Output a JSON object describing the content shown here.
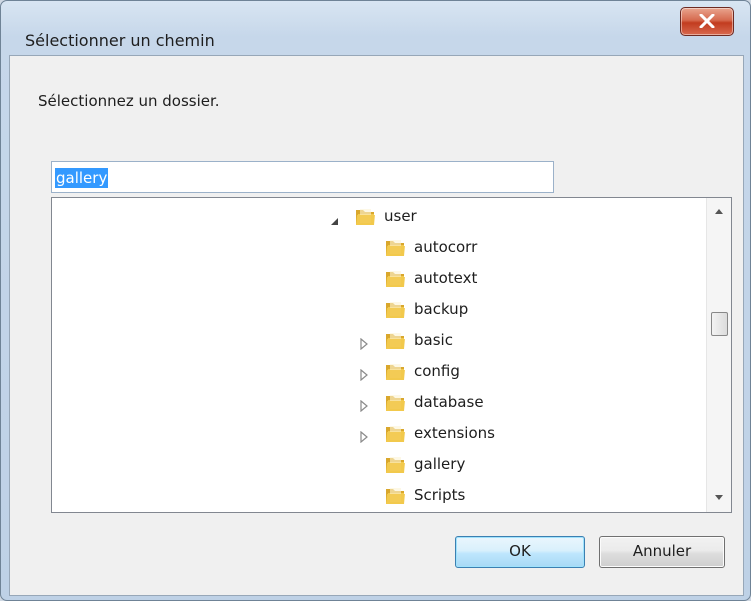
{
  "window": {
    "title": "Sélectionner un chemin",
    "close_label": "X"
  },
  "prompt": "Sélectionnez un dossier.",
  "path_input": {
    "value": "gallery"
  },
  "tree": {
    "items": [
      {
        "label": "user",
        "expander": "expanded"
      },
      {
        "label": "autocorr",
        "expander": "none"
      },
      {
        "label": "autotext",
        "expander": "none"
      },
      {
        "label": "backup",
        "expander": "none"
      },
      {
        "label": "basic",
        "expander": "collapsed"
      },
      {
        "label": "config",
        "expander": "collapsed"
      },
      {
        "label": "database",
        "expander": "collapsed"
      },
      {
        "label": "extensions",
        "expander": "collapsed"
      },
      {
        "label": "gallery",
        "expander": "none"
      },
      {
        "label": "Scripts",
        "expander": "none"
      }
    ]
  },
  "buttons": {
    "ok_label": "OK",
    "cancel_label": "Annuler"
  },
  "colors": {
    "selection": "#3399ff",
    "folder": "#f2c94c",
    "close_button": "#c94a2c"
  }
}
